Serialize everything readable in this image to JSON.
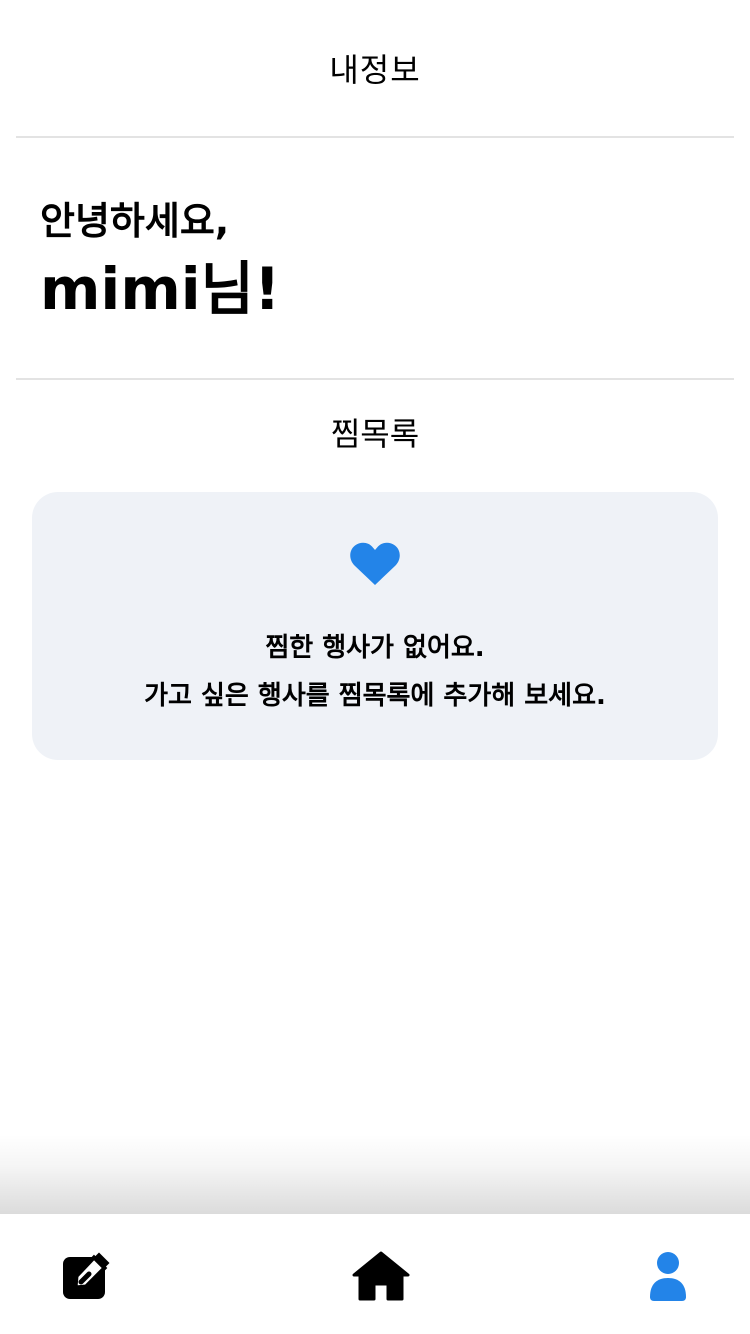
{
  "header": {
    "title": "내정보"
  },
  "greeting": {
    "line1": "안녕하세요,",
    "line2": "mimi님!"
  },
  "wishlist": {
    "title": "찜목록",
    "icon": "heart-icon",
    "empty_line1": "찜한 행사가 없어요.",
    "empty_line2": "가고 싶은 행사를 찜목록에 추가해 보세요."
  },
  "bottom_nav": {
    "items": [
      {
        "icon": "edit-icon",
        "active": false
      },
      {
        "icon": "home-icon",
        "active": false
      },
      {
        "icon": "user-icon",
        "active": true
      }
    ]
  },
  "colors": {
    "accent": "#2384e8",
    "card_background": "#eff2f7",
    "divider": "#e3e3e3",
    "text": "#000000"
  }
}
